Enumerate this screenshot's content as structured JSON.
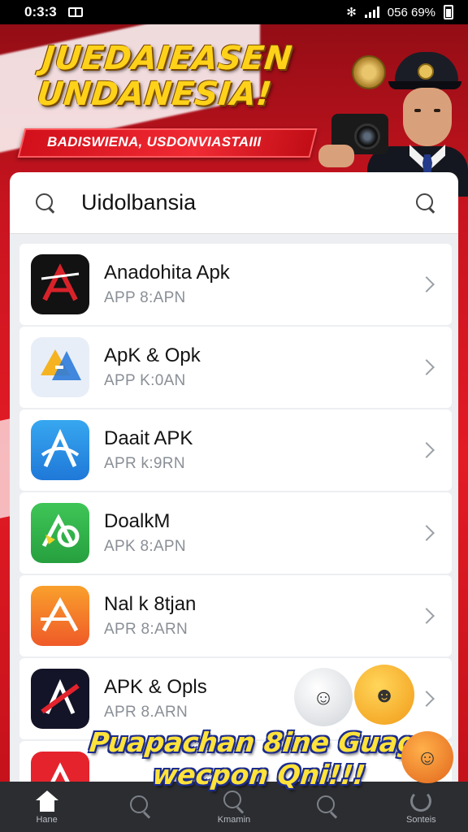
{
  "status_bar": {
    "time": "0:3:3",
    "right_text": "056 69%",
    "icons": [
      "screen-icon",
      "bluetooth-icon",
      "signal-icon",
      "battery-icon"
    ]
  },
  "hero": {
    "title_line1": "JUEDAIEASEN",
    "title_line2": "UNDANESIA!",
    "ribbon_text": "BADISWIENA, USDONVIASTAIII"
  },
  "search": {
    "value": "Uidolbansia",
    "icons": [
      "search-icon",
      "search-icon"
    ]
  },
  "apps": [
    {
      "name": "Anadohita Apk",
      "sub": "APP 8:APN",
      "icon_color": "#121212",
      "icon_accent": "#d8222a",
      "glyph": "A"
    },
    {
      "name": "ApK & Opk",
      "sub": "APP K:0AN",
      "icon_color": "#e8eef7",
      "icon_accent": "#2e7bd9",
      "glyph": "A"
    },
    {
      "name": "Daait APK",
      "sub": "APR k:9RN",
      "icon_color": "#2b8fe6",
      "icon_accent": "#ffffff",
      "glyph": "A"
    },
    {
      "name": "DoalkM",
      "sub": "APK 8:APN",
      "icon_color": "#34b44a",
      "icon_accent": "#f2d22b",
      "glyph": "A"
    },
    {
      "name": "Nal k 8tjan",
      "sub": "APR 8:ARN",
      "icon_color": "#f26b2a",
      "icon_accent": "#ffffff",
      "glyph": "A"
    },
    {
      "name": "APK & Opls",
      "sub": "APR 8.ARN",
      "icon_color": "#141428",
      "icon_accent": "#e2232c",
      "glyph": "A"
    },
    {
      "name": "",
      "sub": "",
      "icon_color": "#e5232c",
      "icon_accent": "#ffffff",
      "glyph": "A"
    }
  ],
  "promo": {
    "line1": "Puapachan 8ine Guag",
    "line2": "wecpon Qni!!!"
  },
  "bottom_nav": [
    {
      "label": "Hane",
      "icon": "home-icon"
    },
    {
      "label": "",
      "icon": "search-icon"
    },
    {
      "label": "Kmamin",
      "icon": "search-icon"
    },
    {
      "label": "",
      "icon": "search-icon"
    },
    {
      "label": "Sonteis",
      "icon": "settings-icon"
    }
  ],
  "colors": {
    "banner_red": "#e31b25",
    "title_yellow": "#ffd21a",
    "nav_bg": "#2b2d31"
  }
}
